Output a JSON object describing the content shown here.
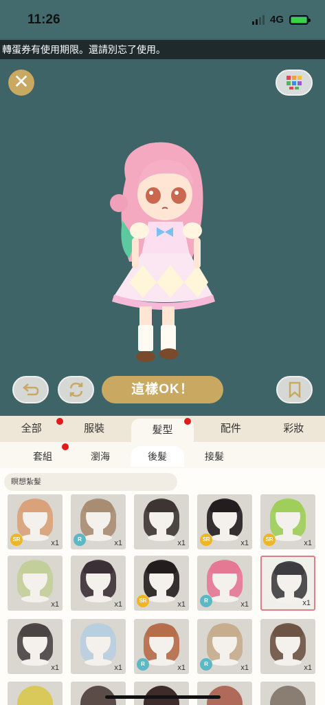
{
  "status": {
    "time": "11:26",
    "network": "4G"
  },
  "marquee": "轉蛋券有使用期限。還請別忘了使用。",
  "buttons": {
    "ok": "這樣OK！"
  },
  "tabs_main": [
    {
      "label": "全部"
    },
    {
      "label": "服裝"
    },
    {
      "label": "髮型",
      "active": true
    },
    {
      "label": "配件"
    },
    {
      "label": "彩妝"
    }
  ],
  "tabs_sub": [
    {
      "label": "套組"
    },
    {
      "label": "瀏海"
    },
    {
      "label": "後髮",
      "active": true
    },
    {
      "label": "接髮"
    }
  ],
  "filter_label": "瞑想紮髮",
  "items": [
    {
      "rarity": "SR",
      "count": "x1",
      "hair": "#d9a27a"
    },
    {
      "rarity": "R",
      "count": "x1",
      "hair": "#a88d72"
    },
    {
      "rarity": "",
      "count": "x1",
      "hair": "#3d3532"
    },
    {
      "rarity": "SR",
      "count": "x1",
      "hair": "#231d1f"
    },
    {
      "rarity": "SR",
      "count": "x1",
      "hair": "#9fcf5a"
    },
    {
      "rarity": "",
      "count": "x1",
      "hair": "#c3cf9a"
    },
    {
      "rarity": "",
      "count": "x1",
      "hair": "#3a3036"
    },
    {
      "rarity": "SR",
      "count": "x1",
      "hair": "#241d1e"
    },
    {
      "rarity": "R",
      "count": "x1",
      "hair": "#e57893"
    },
    {
      "rarity": "",
      "count": "x1",
      "hair": "#3d3c40",
      "selected": true
    },
    {
      "rarity": "",
      "count": "x1",
      "hair": "#4a4445"
    },
    {
      "rarity": "",
      "count": "x1",
      "hair": "#b8cfe0"
    },
    {
      "rarity": "R",
      "count": "x1",
      "hair": "#b56d4a"
    },
    {
      "rarity": "R",
      "count": "x1",
      "hair": "#c5ad8d"
    },
    {
      "rarity": "",
      "count": "x1",
      "hair": "#6d5445"
    }
  ]
}
